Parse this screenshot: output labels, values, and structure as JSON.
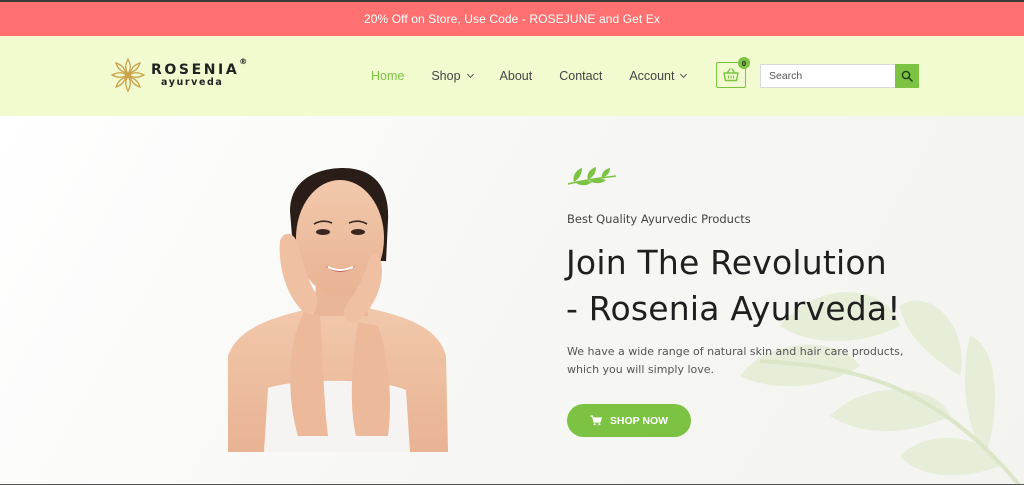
{
  "promo": {
    "text": "20% Off on Store, Use Code - ROSEJUNE and Get Ex"
  },
  "brand": {
    "name": "ROSENIA",
    "registered": "®",
    "sub": "ayurveda"
  },
  "nav": {
    "items": [
      {
        "label": "Home",
        "active": true
      },
      {
        "label": "Shop",
        "dropdown": true
      },
      {
        "label": "About"
      },
      {
        "label": "Contact"
      },
      {
        "label": "Account",
        "dropdown": true
      }
    ]
  },
  "cart": {
    "count": "0",
    "icon": "basket-icon"
  },
  "search": {
    "placeholder": "Search",
    "value": "",
    "icon": "search-icon"
  },
  "hero": {
    "eyebrow": "Best Quality Ayurvedic Products",
    "headline_line1": "Join The Revolution",
    "headline_line2": "- Rosenia Ayurveda!",
    "description": "We have a wide range of natural skin and hair care products, which you will simply love.",
    "cta_label": "SHOP NOW"
  },
  "colors": {
    "promo": "#ff7171",
    "header_bg": "#f1fbcf",
    "accent": "#7cc243"
  }
}
